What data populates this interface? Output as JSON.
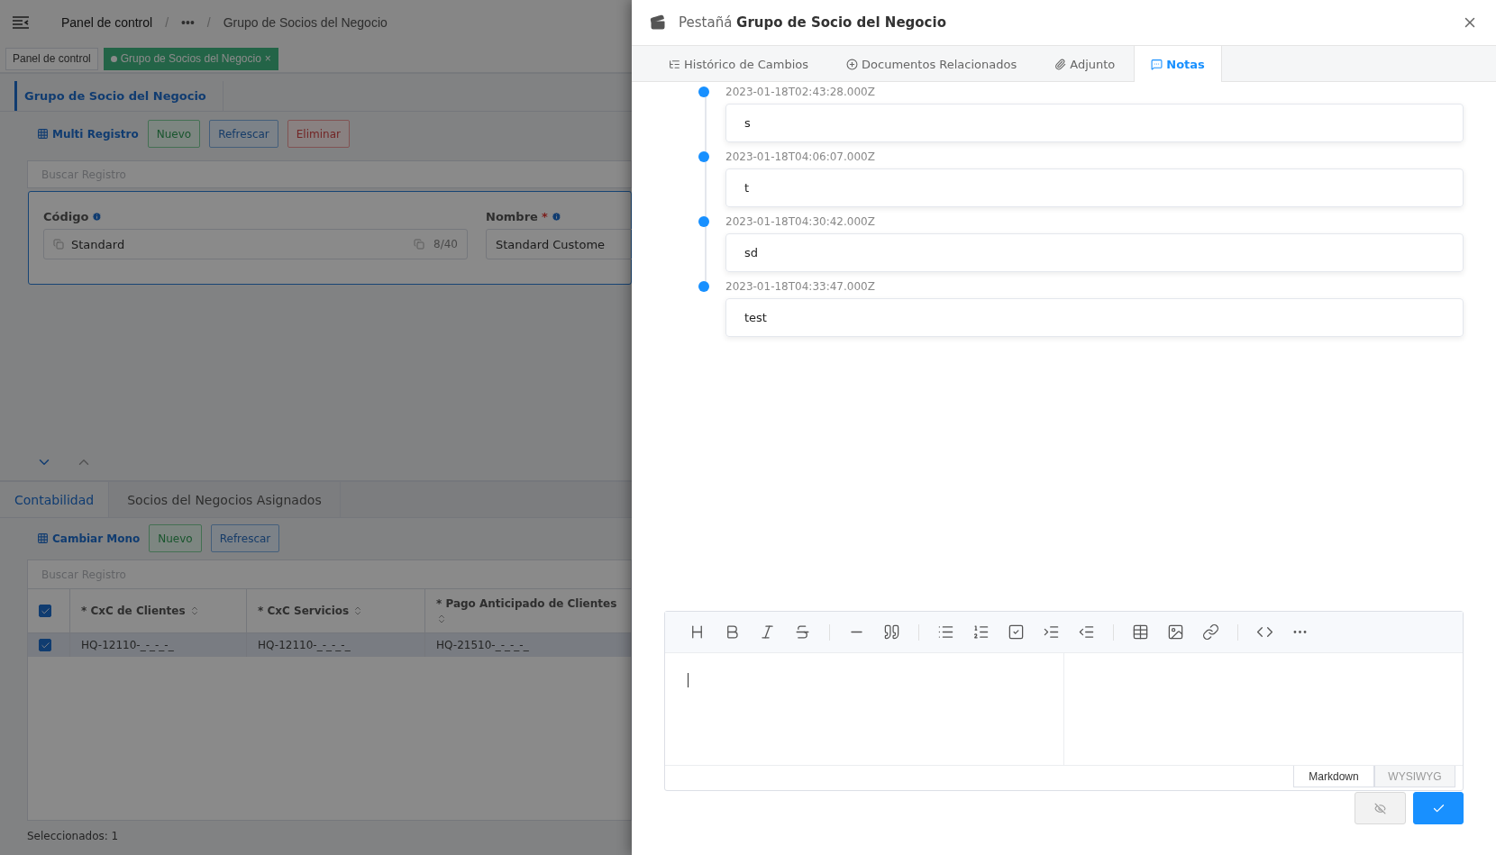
{
  "background_page": {
    "breadcrumbs": [
      {
        "label": "Panel de control"
      },
      {
        "separator": "/",
        "label": "•••"
      },
      {
        "separator": "/",
        "label": "Grupo de Socios del Negocio"
      }
    ],
    "open_tabs": [
      {
        "label": "Panel de control",
        "selected": false
      },
      {
        "label": "Grupo de Socios del Negocio",
        "selected": true,
        "close": "×"
      }
    ],
    "panel_title": "Grupo de Socio del Negocio",
    "toolbar": [
      {
        "kind": "link",
        "label": "Multi Registro"
      },
      {
        "kind": "green",
        "label": "Nuevo"
      },
      {
        "kind": "blue",
        "label": "Refrescar"
      },
      {
        "kind": "red",
        "label": "Eliminar"
      }
    ],
    "search": {
      "placeholder": "Buscar Registro"
    },
    "fields": [
      {
        "label": "Código",
        "value": "Standard",
        "counter": "8/40"
      },
      {
        "label": "Nombre",
        "required_mark": "*",
        "value": "Standard Custome"
      }
    ],
    "detail_tabs": [
      {
        "label": "Contabilidad",
        "selected": true
      },
      {
        "label": "Socios del Negocios Asignados",
        "selected": false
      }
    ],
    "detail_toolbar": [
      {
        "kind": "link",
        "label": "Cambiar Mono"
      },
      {
        "kind": "green",
        "label": "Nuevo"
      },
      {
        "kind": "blue",
        "label": "Refrescar"
      }
    ],
    "detail_search": {
      "placeholder": "Buscar Registro"
    },
    "table": {
      "all_checked": true,
      "columns": [
        "* CxC de Clientes",
        "* CxC Servicios",
        "* Pago Anticipado de Clientes"
      ],
      "rows": [
        {
          "selected": true,
          "cells": [
            "HQ-12110-_-_-_-_",
            "HQ-12110-_-_-_-_",
            "HQ-21510-_-_-_-_"
          ]
        }
      ]
    },
    "footer": "Seleccionados: 1"
  },
  "drawer": {
    "title_prefix": "Pestañá",
    "title": "Grupo de Socio del Negocio",
    "tabs": [
      {
        "kind": "history",
        "label": "Histórico de Cambios",
        "selected": false
      },
      {
        "kind": "documents",
        "label": "Documentos Relacionados",
        "selected": false
      },
      {
        "kind": "attachment",
        "label": "Adjunto",
        "selected": false
      },
      {
        "kind": "notes",
        "label": "Notas",
        "selected": true
      }
    ],
    "notes": [
      {
        "time": "2023-01-18T02:43:28.000Z",
        "text": "s"
      },
      {
        "time": "2023-01-18T04:06:07.000Z",
        "text": "t"
      },
      {
        "time": "2023-01-18T04:30:42.000Z",
        "text": "sd"
      },
      {
        "time": "2023-01-18T04:33:47.000Z",
        "text": "test"
      }
    ],
    "editor_modes": [
      {
        "label": "Markdown",
        "selected": true
      },
      {
        "label": "WYSIWYG",
        "selected": false
      }
    ]
  }
}
